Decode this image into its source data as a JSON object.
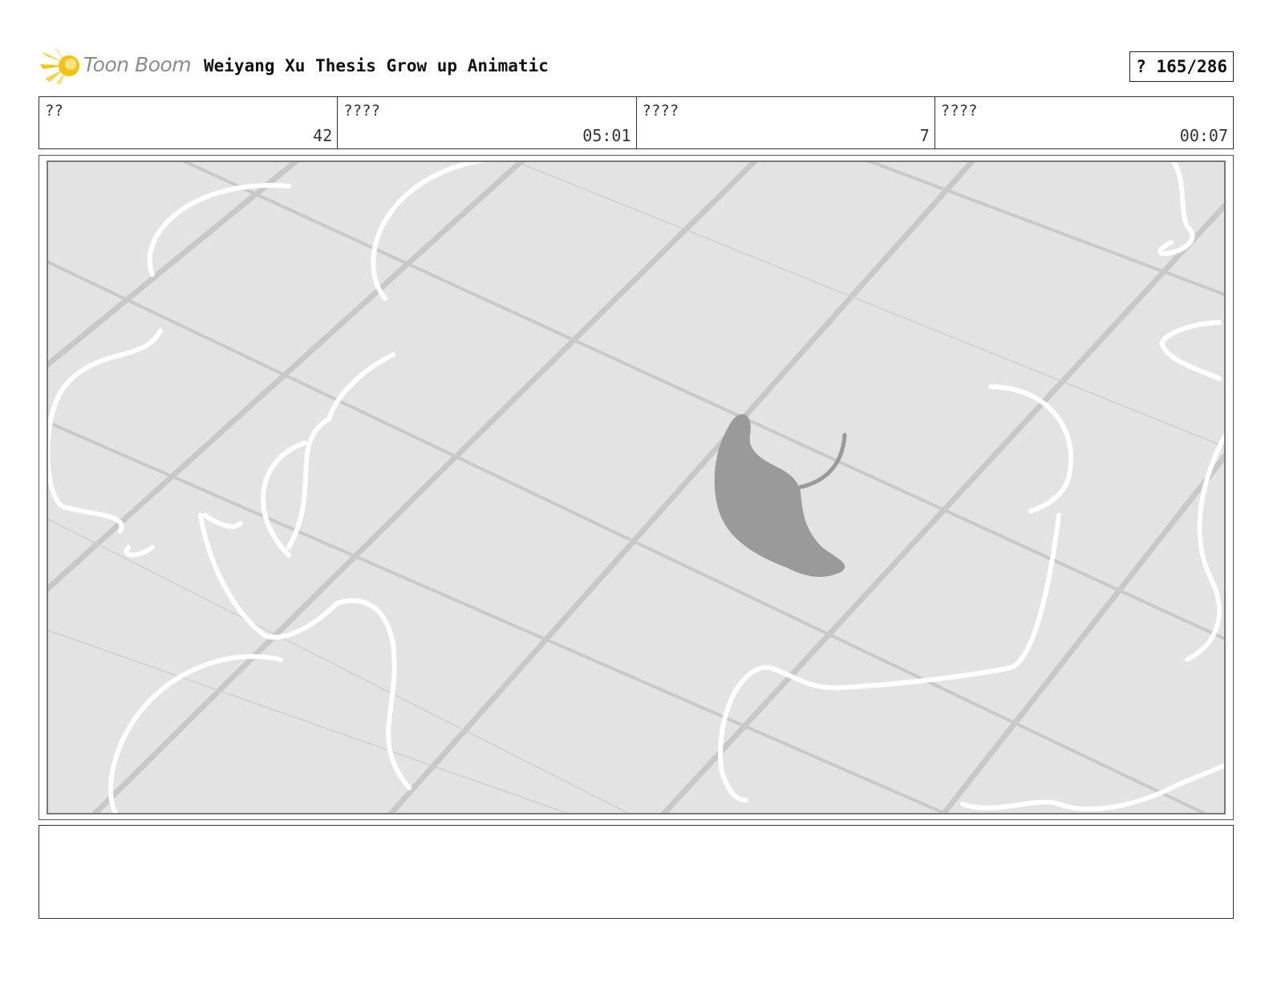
{
  "header": {
    "logo_text": "Toon Boom",
    "title": "Weiyang Xu Thesis Grow up Animatic",
    "page_indicator": "? 165/286"
  },
  "info": [
    {
      "label": "??",
      "value": "42"
    },
    {
      "label": "????",
      "value": "05:01"
    },
    {
      "label": "????",
      "value": "7"
    },
    {
      "label": "????",
      "value": "00:07"
    }
  ],
  "colors": {
    "logo_yellow": "#f5c211",
    "background_tile": "#e3e3e3",
    "grid_line": "#c6c6c6",
    "leaf": "#999999",
    "wind_stroke": "#ffffff"
  },
  "panel": {
    "icons": [
      "toon-boom-logo-icon",
      "leaf-icon"
    ]
  },
  "notes": {
    "text": ""
  }
}
